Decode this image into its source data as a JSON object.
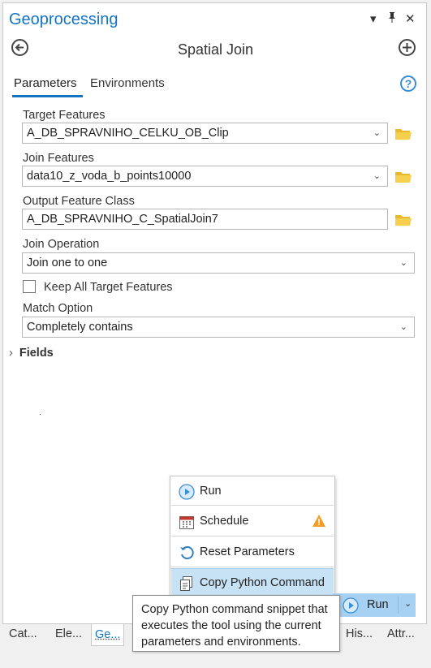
{
  "pane": {
    "title": "Geoprocessing",
    "controls": {
      "options": "▾",
      "pin": "🖈",
      "close": "✕"
    }
  },
  "header": {
    "back": "←",
    "tool_name": "Spatial Join",
    "add": "+"
  },
  "tabs": {
    "parameters": "Parameters",
    "environments": "Environments",
    "help": "?"
  },
  "params": {
    "target_features": {
      "label": "Target Features",
      "value": "A_DB_SPRAVNIHO_CELKU_OB_Clip"
    },
    "join_features": {
      "label": "Join Features",
      "value": "data10_z_voda_b_points10000"
    },
    "output_feature_class": {
      "label": "Output Feature Class",
      "value": "A_DB_SPRAVNIHO_C_SpatialJoin7"
    },
    "join_operation": {
      "label": "Join Operation",
      "value": "Join one to one"
    },
    "keep_all": {
      "label": "Keep All Target Features",
      "checked": false
    },
    "match_option": {
      "label": "Match Option",
      "value": "Completely contains"
    },
    "fields": {
      "label": "Fields"
    }
  },
  "menu": {
    "items": [
      {
        "label": "Run",
        "icon": "play-icon"
      },
      {
        "label": "Schedule",
        "icon": "calendar-icon",
        "warning": true
      },
      {
        "label": "Reset Parameters",
        "icon": "reset-icon"
      },
      {
        "label": "Copy Python Command",
        "icon": "copy-icon",
        "highlighted": true
      }
    ]
  },
  "run_button": {
    "label": "Run"
  },
  "tooltip": {
    "text": "Copy Python command snippet that executes the tool using the current parameters and environments."
  },
  "bottom_tabs": [
    "Cat...",
    "Ele...",
    "Ge...",
    "His...",
    "Attr..."
  ],
  "colors": {
    "accent": "#1474c4",
    "highlight": "#c7e1f5",
    "run": "#a6d1f3",
    "folder": "#e8b92d",
    "warning": "#f39c1f"
  }
}
